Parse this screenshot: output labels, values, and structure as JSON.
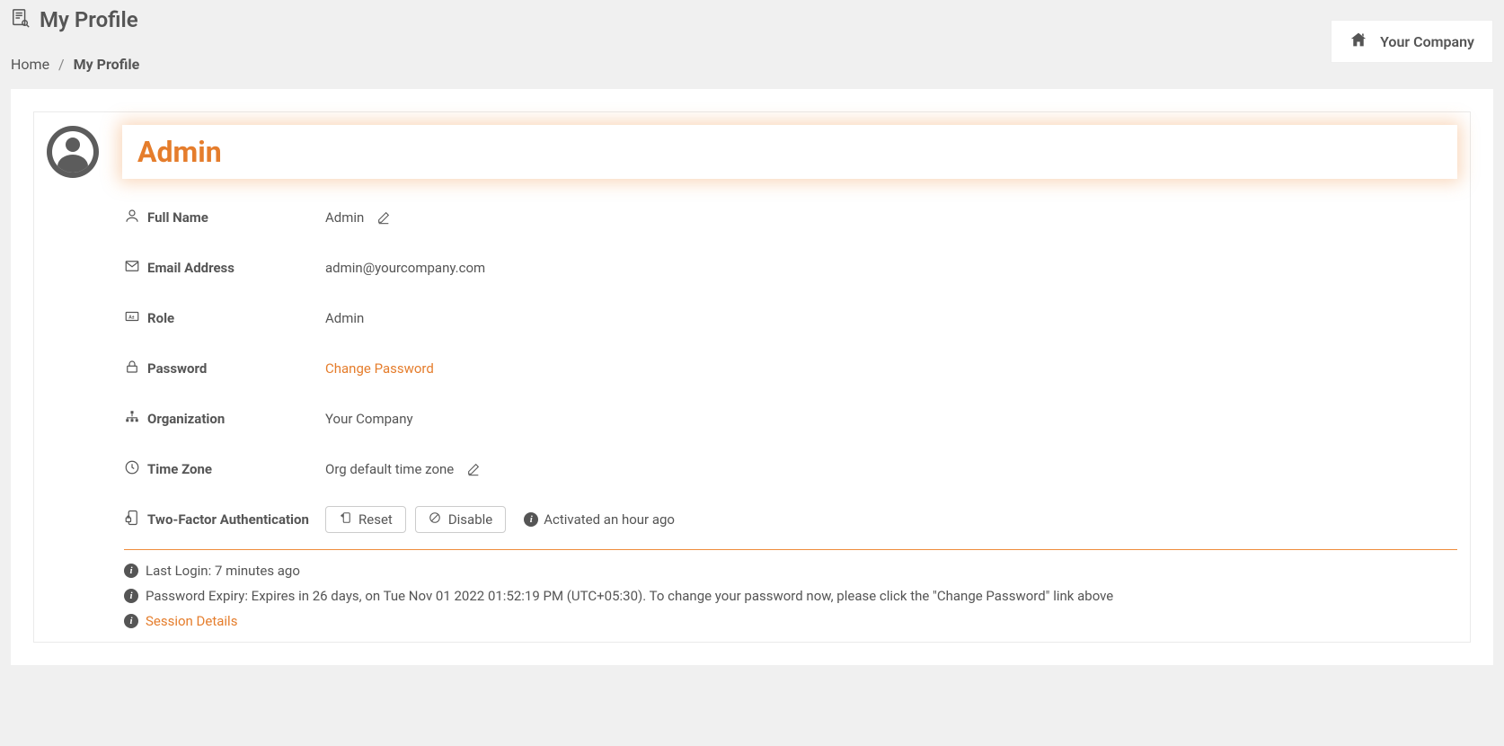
{
  "page": {
    "title": "My Profile"
  },
  "breadcrumb": {
    "home": "Home",
    "current": "My Profile"
  },
  "company": {
    "name": "Your Company"
  },
  "profile": {
    "display_name": "Admin",
    "fields": {
      "full_name": {
        "label": "Full Name",
        "value": "Admin"
      },
      "email": {
        "label": "Email Address",
        "value": "admin@yourcompany.com"
      },
      "role": {
        "label": "Role",
        "value": "Admin"
      },
      "password": {
        "label": "Password",
        "change_link": "Change Password"
      },
      "organization": {
        "label": "Organization",
        "value": "Your Company"
      },
      "timezone": {
        "label": "Time Zone",
        "value": "Org default time zone"
      },
      "tfa": {
        "label": "Two-Factor Authentication",
        "reset": "Reset",
        "disable": "Disable",
        "activated": "Activated an hour ago"
      }
    },
    "footer": {
      "last_login": "Last Login: 7 minutes ago",
      "password_expiry": "Password Expiry: Expires in 26 days, on Tue Nov 01 2022 01:52:19 PM (UTC+05:30). To change your password now, please click the \"Change Password\" link above",
      "session_details": "Session Details"
    }
  }
}
